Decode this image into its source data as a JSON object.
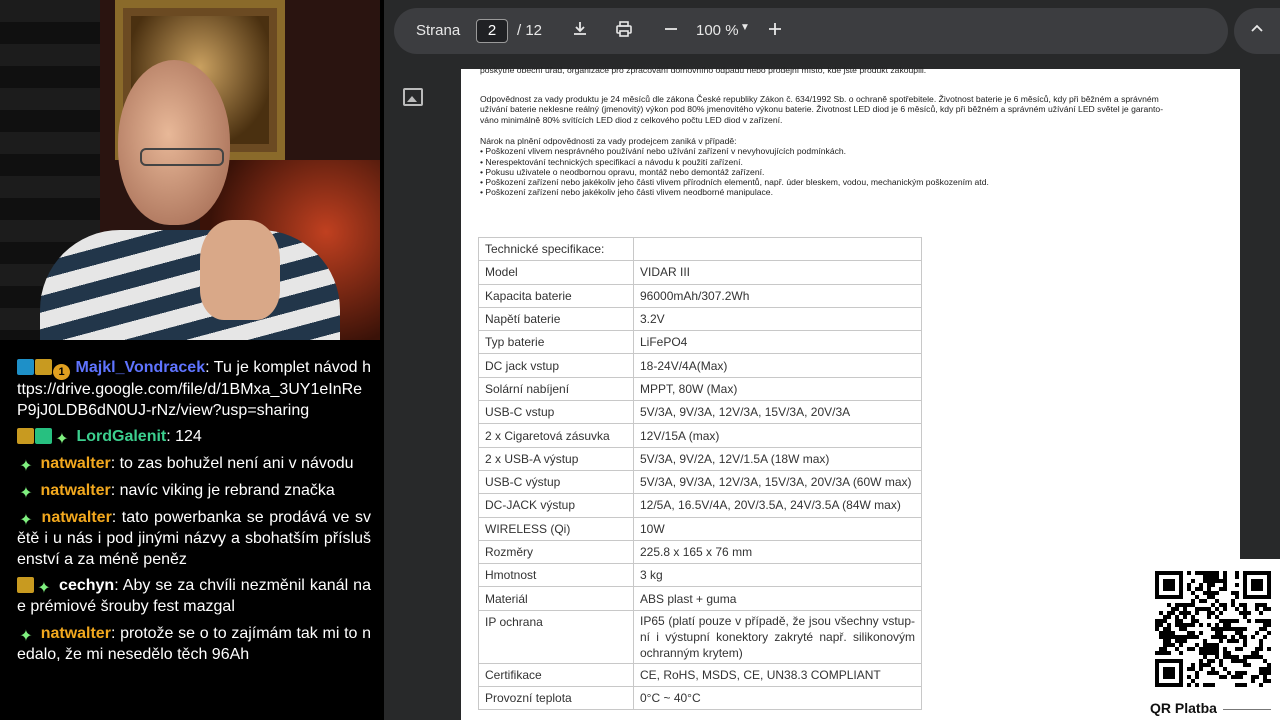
{
  "chat": [
    {
      "badges": [
        "blue",
        "gold",
        "circle"
      ],
      "badge_text": "1",
      "user": "Majkl_Vondracek",
      "user_color": "#5f74ff",
      "text": "Tu je komplet návod https://drive.google.com/file/d/1BMxa_3UY1eInReP9jJ0LDB6dN0UJ-rNz/view?usp=sharing"
    },
    {
      "badges": [
        "gold",
        "green",
        "star"
      ],
      "user": "LordGalenit",
      "user_color": "#3ccf8e",
      "text": "124"
    },
    {
      "badges": [
        "star"
      ],
      "user": "natwalter",
      "user_color": "#f2a81e",
      "text": "to zas bohužel není ani v návodu"
    },
    {
      "badges": [
        "star"
      ],
      "user": "natwalter",
      "user_color": "#f2a81e",
      "text": "navíc viking je rebrand značka"
    },
    {
      "badges": [
        "star"
      ],
      "user": "natwalter",
      "user_color": "#f2a81e",
      "text": "tato powerbanka se prodává ve světě i u nás i pod jinými názvy a sbohatším příslušenství a za méně peněz"
    },
    {
      "badges": [
        "gold",
        "star"
      ],
      "user": "cechyn",
      "user_color": "#ffffff",
      "text": "Aby se za chvíli nezměnil kanál na e prémiové šrouby fest mazgal"
    },
    {
      "badges": [
        "star"
      ],
      "user": "natwalter",
      "user_color": "#f2a81e",
      "text": "protože se o to zajímám tak mi to nedalo, že mi nesedělo těch 96Ah"
    }
  ],
  "toolbar": {
    "page_label": "Strana",
    "page_current": "2",
    "page_total": "/ 12",
    "zoom": "100 %",
    "icons": [
      "download-icon",
      "print-icon",
      "minus-icon",
      "plus-icon",
      "chevron-up-icon"
    ]
  },
  "page": {
    "p1": "poskytne obecní úřad, organizace pro zpracování domovního odpadu nebo prodejní místo, kde jste produkt zakoupili.",
    "p2_lines": [
      "Odpovědnost za vady produktu je 24 měsíců dle zákona České republiky Zákon č. 634/1992 Sb. o ochraně spotřebitele.  Životnost baterie je 6 měsíců, kdy při běžném a správném",
      "užívání baterie neklesne reálný (jmenovitý) výkon pod 80% jmenovitého výkonu baterie. Životnost LED diod je 6 měsíců, kdy při běžném a správném užívání LED světel je garanto-",
      "váno minimálně 80% svítících LED diod z celkového počtu LED diod v zařízení."
    ],
    "p3_lines": [
      "Nárok na plnění odpovědnosti za vady prodejcem zaniká v případě:",
      "•  Poškození vlivem nesprávného používání nebo užívání zařízení v nevyhovujících podmínkách.",
      "•  Nerespektování technických specifikací a návodu k použití zařízení.",
      "•  Pokusu uživatele o neodbornou opravu, montáž nebo demontáž zařízení.",
      "•  Poškození zařízení nebo jakékoliv jeho části vlivem přírodních elementů, např. úder bleskem, vodou, mechanickým poškozením atd.",
      "•  Poškození zařízení nebo jakékoliv jeho části vlivem neodborné manipulace."
    ],
    "spec": [
      [
        "Technické specifikace:",
        ""
      ],
      [
        "Model",
        "VIDAR III"
      ],
      [
        "Kapacita baterie",
        "96000mAh/307.2Wh"
      ],
      [
        "Napětí baterie",
        "3.2V"
      ],
      [
        "Typ baterie",
        "LiFePO4"
      ],
      [
        "DC jack vstup",
        "18-24V/4A(Max)"
      ],
      [
        "Solární nabíjení",
        "MPPT, 80W (Max)"
      ],
      [
        "USB-C vstup",
        "5V/3A, 9V/3A, 12V/3A, 15V/3A, 20V/3A"
      ],
      [
        "2 x Cigaretová zásuvka",
        "12V/15A (max)"
      ],
      [
        "2 x USB-A výstup",
        "5V/3A, 9V/2A, 12V/1.5A (18W max)"
      ],
      [
        "USB-C výstup",
        "5V/3A, 9V/3A, 12V/3A, 15V/3A, 20V/3A (60W max)"
      ],
      [
        "DC-JACK výstup",
        "12/5A, 16.5V/4A, 20V/3.5A, 24V/3.5A (84W max)"
      ],
      [
        "WIRELESS (Qi)",
        "10W"
      ],
      [
        "Rozměry",
        "225.8 x 165 x 76 mm"
      ],
      [
        "Hmotnost",
        "3 kg"
      ],
      [
        "Materiál",
        "ABS plast + guma"
      ],
      [
        "IP ochrana",
        "IP65 (platí pouze v případě, že jsou všechny vstup-ní i výstupní konektory zakryté např. silikonovým ochranným krytem)"
      ],
      [
        "Certifikace",
        "CE, RoHS, MSDS, CE, UN38.3 COMPLIANT"
      ],
      [
        "Provozní teplota",
        "0°C ~ 40°C"
      ]
    ]
  },
  "qr": {
    "label": "QR Platba"
  }
}
